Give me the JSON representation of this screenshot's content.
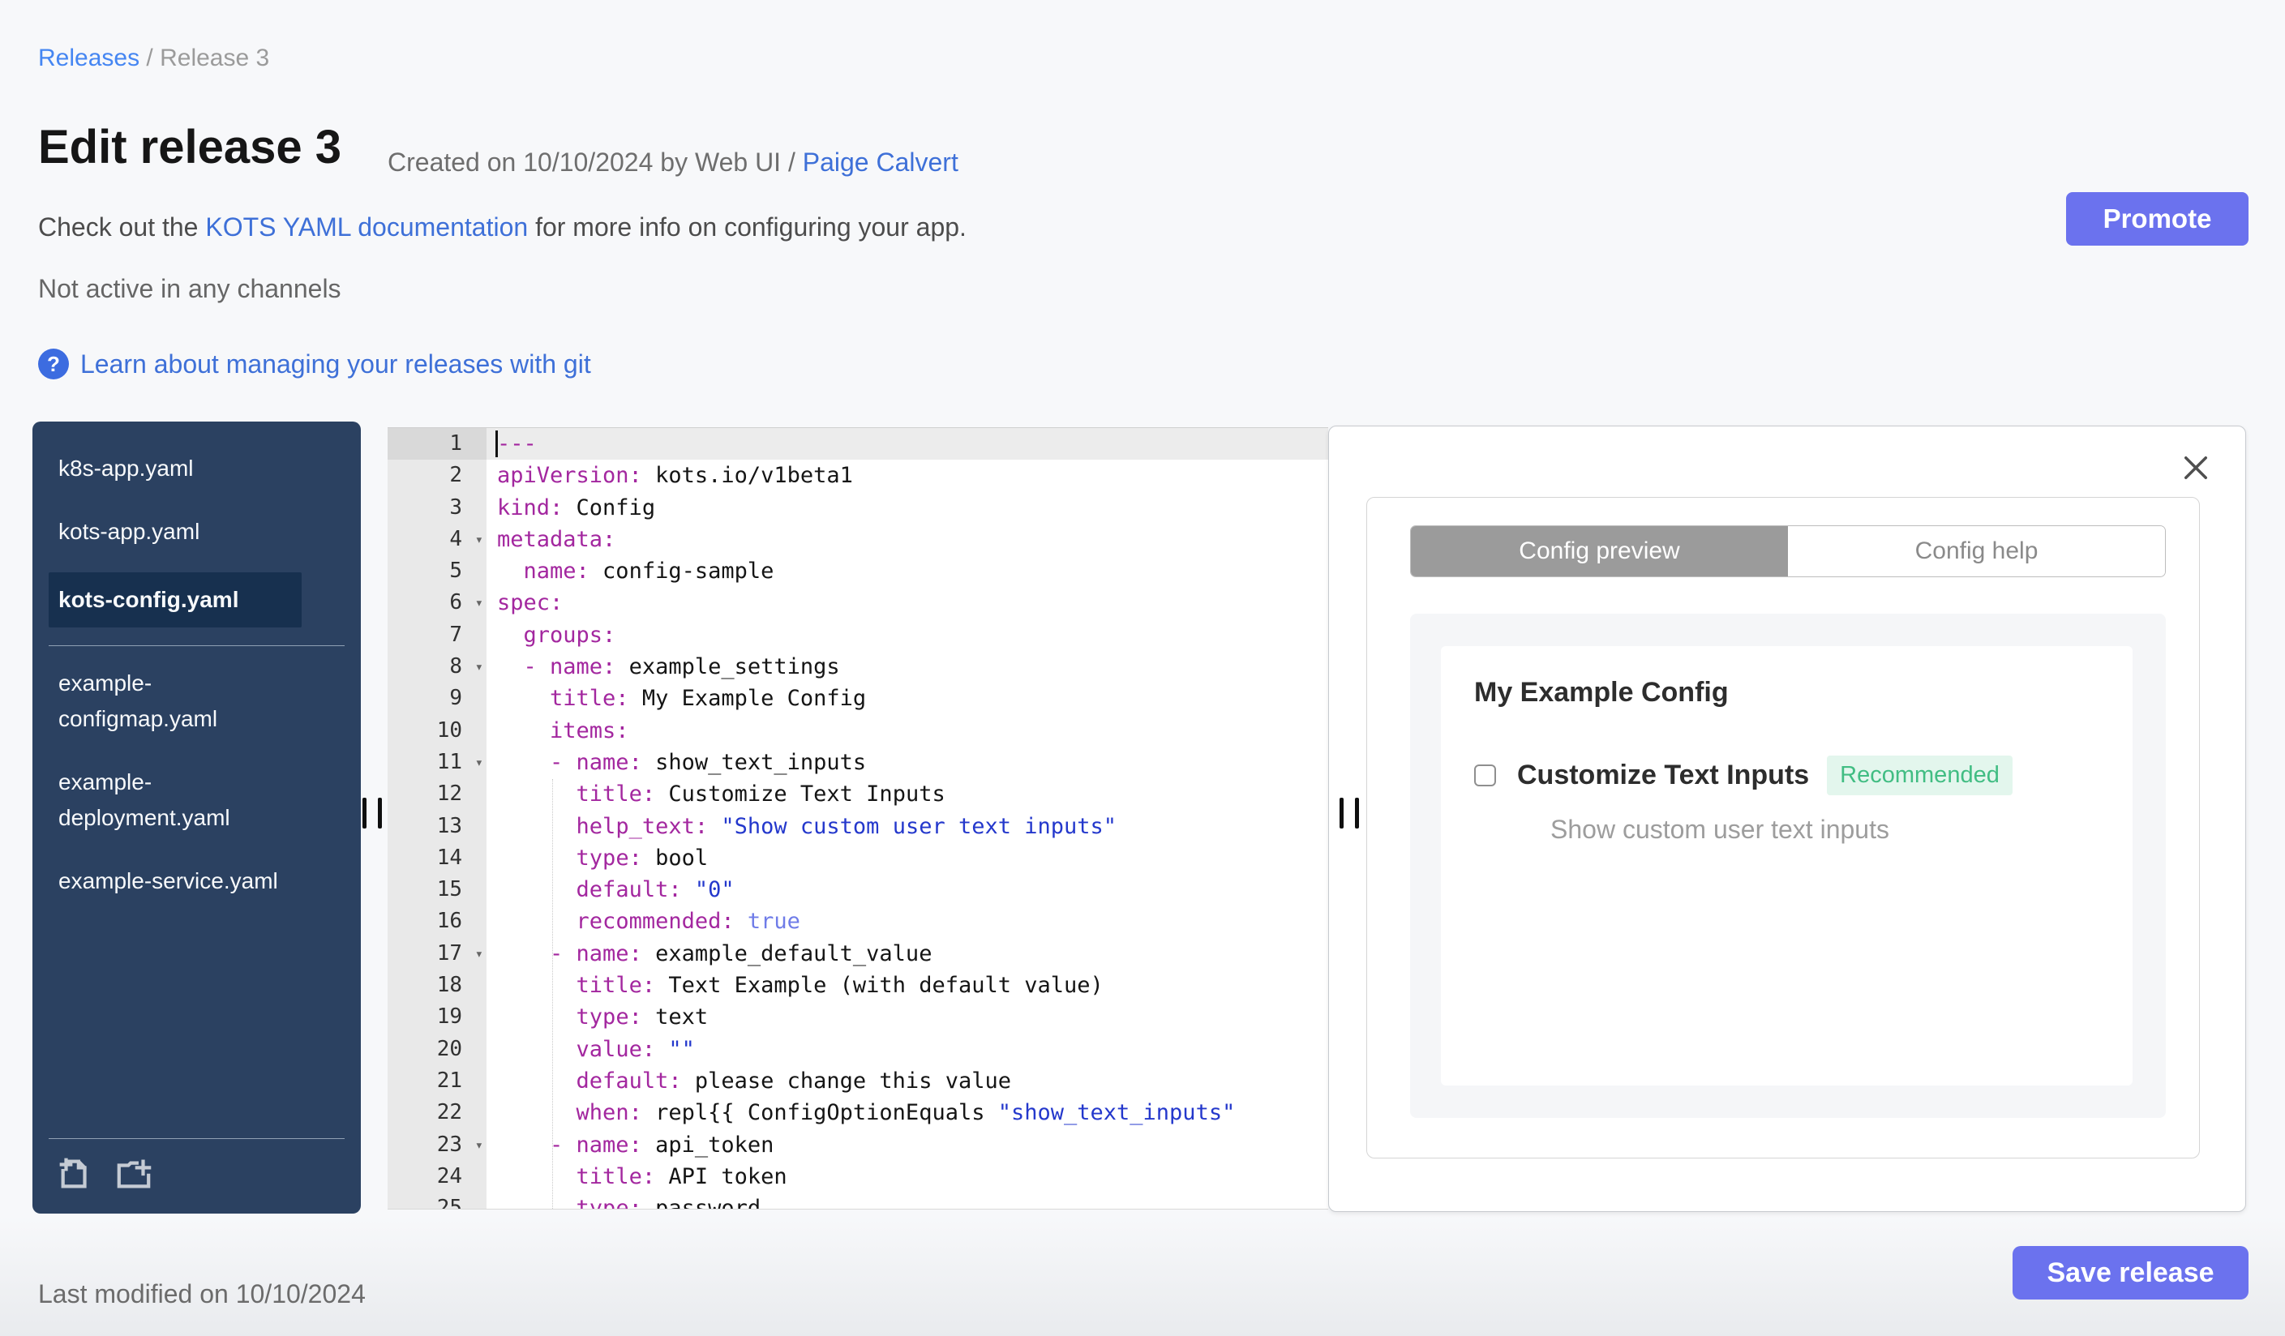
{
  "colors": {
    "accent": "#6b72ee",
    "link": "#3e70d8",
    "breadcrumb_link": "#4586f2",
    "sidebar_bg": "#2b4161",
    "sidebar_selected": "#17304f",
    "tab_active": "#9b9b9b",
    "badge_text": "#41bd83",
    "badge_bg": "#e3f6ed",
    "code_key": "#a3279f",
    "code_string": "#2438cc",
    "code_bool": "#6f7ce8"
  },
  "breadcrumb": {
    "link": "Releases",
    "separator": " / ",
    "current": "Release 3"
  },
  "header": {
    "title": "Edit release 3",
    "created_prefix": "Created on 10/10/2024 by Web UI / ",
    "created_link": "Paige Calvert",
    "doc_prefix": "Check out the ",
    "doc_link": "KOTS YAML documentation",
    "doc_suffix": " for more info on configuring your app.",
    "promote_label": "Promote",
    "status": "Not active in any channels",
    "help_icon": "?",
    "git_link": "Learn about managing your releases with git"
  },
  "sidebar": {
    "files_top": [
      {
        "label": "k8s-app.yaml",
        "selected": false
      },
      {
        "label": "kots-app.yaml",
        "selected": false
      },
      {
        "label": "kots-config.yaml",
        "selected": true
      }
    ],
    "files_bottom": [
      {
        "label": "example-configmap.yaml",
        "selected": false
      },
      {
        "label": "example-deployment.yaml",
        "selected": false
      },
      {
        "label": "example-service.yaml",
        "selected": false
      }
    ],
    "icons": [
      "new-file-icon",
      "new-folder-icon"
    ]
  },
  "editor": {
    "fold_icon": "▾",
    "lines": [
      {
        "fold": false,
        "active": true,
        "segs": [
          [
            "key",
            "---"
          ]
        ]
      },
      {
        "fold": false,
        "active": false,
        "segs": [
          [
            "key",
            "apiVersion:"
          ],
          [
            "plain",
            " kots.io/v1beta1"
          ]
        ]
      },
      {
        "fold": false,
        "active": false,
        "segs": [
          [
            "key",
            "kind:"
          ],
          [
            "plain",
            " Config"
          ]
        ]
      },
      {
        "fold": true,
        "active": false,
        "segs": [
          [
            "key",
            "metadata:"
          ]
        ]
      },
      {
        "fold": false,
        "active": false,
        "segs": [
          [
            "plain",
            "  "
          ],
          [
            "key",
            "name:"
          ],
          [
            "plain",
            " config-sample"
          ]
        ]
      },
      {
        "fold": true,
        "active": false,
        "segs": [
          [
            "key",
            "spec:"
          ]
        ]
      },
      {
        "fold": false,
        "active": false,
        "segs": [
          [
            "plain",
            "  "
          ],
          [
            "key",
            "groups:"
          ]
        ]
      },
      {
        "fold": true,
        "active": false,
        "segs": [
          [
            "plain",
            "  "
          ],
          [
            "key",
            "- name:"
          ],
          [
            "plain",
            " example_settings"
          ]
        ]
      },
      {
        "fold": false,
        "active": false,
        "segs": [
          [
            "plain",
            "    "
          ],
          [
            "key",
            "title:"
          ],
          [
            "plain",
            " My Example Config"
          ]
        ]
      },
      {
        "fold": false,
        "active": false,
        "segs": [
          [
            "plain",
            "    "
          ],
          [
            "key",
            "items:"
          ]
        ]
      },
      {
        "fold": true,
        "active": false,
        "segs": [
          [
            "plain",
            "    "
          ],
          [
            "key",
            "- name:"
          ],
          [
            "plain",
            " show_text_inputs"
          ]
        ]
      },
      {
        "fold": false,
        "active": false,
        "segs": [
          [
            "plain",
            "      "
          ],
          [
            "key",
            "title:"
          ],
          [
            "plain",
            " Customize Text Inputs"
          ]
        ]
      },
      {
        "fold": false,
        "active": false,
        "segs": [
          [
            "plain",
            "      "
          ],
          [
            "key",
            "help_text:"
          ],
          [
            "plain",
            " "
          ],
          [
            "string",
            "\"Show custom user text inputs\""
          ]
        ]
      },
      {
        "fold": false,
        "active": false,
        "segs": [
          [
            "plain",
            "      "
          ],
          [
            "key",
            "type:"
          ],
          [
            "plain",
            " bool"
          ]
        ]
      },
      {
        "fold": false,
        "active": false,
        "segs": [
          [
            "plain",
            "      "
          ],
          [
            "key",
            "default:"
          ],
          [
            "plain",
            " "
          ],
          [
            "string",
            "\"0\""
          ]
        ]
      },
      {
        "fold": false,
        "active": false,
        "segs": [
          [
            "plain",
            "      "
          ],
          [
            "key",
            "recommended:"
          ],
          [
            "plain",
            " "
          ],
          [
            "bool",
            "true"
          ]
        ]
      },
      {
        "fold": true,
        "active": false,
        "segs": [
          [
            "plain",
            "    "
          ],
          [
            "key",
            "- name:"
          ],
          [
            "plain",
            " example_default_value"
          ]
        ]
      },
      {
        "fold": false,
        "active": false,
        "segs": [
          [
            "plain",
            "      "
          ],
          [
            "key",
            "title:"
          ],
          [
            "plain",
            " Text Example (with default value)"
          ]
        ]
      },
      {
        "fold": false,
        "active": false,
        "segs": [
          [
            "plain",
            "      "
          ],
          [
            "key",
            "type:"
          ],
          [
            "plain",
            " text"
          ]
        ]
      },
      {
        "fold": false,
        "active": false,
        "segs": [
          [
            "plain",
            "      "
          ],
          [
            "key",
            "value:"
          ],
          [
            "plain",
            " "
          ],
          [
            "string",
            "\"\""
          ]
        ]
      },
      {
        "fold": false,
        "active": false,
        "segs": [
          [
            "plain",
            "      "
          ],
          [
            "key",
            "default:"
          ],
          [
            "plain",
            " please change this value"
          ]
        ]
      },
      {
        "fold": false,
        "active": false,
        "segs": [
          [
            "plain",
            "      "
          ],
          [
            "key",
            "when:"
          ],
          [
            "plain",
            " repl{{ ConfigOptionEquals "
          ],
          [
            "string",
            "\"show_text_inputs\""
          ]
        ]
      },
      {
        "fold": true,
        "active": false,
        "segs": [
          [
            "plain",
            "    "
          ],
          [
            "key",
            "- name:"
          ],
          [
            "plain",
            " api_token"
          ]
        ]
      },
      {
        "fold": false,
        "active": false,
        "segs": [
          [
            "plain",
            "      "
          ],
          [
            "key",
            "title:"
          ],
          [
            "plain",
            " API token"
          ]
        ]
      },
      {
        "fold": false,
        "active": false,
        "segs": [
          [
            "plain",
            "      "
          ],
          [
            "key",
            "type:"
          ],
          [
            "plain",
            " password"
          ]
        ]
      }
    ]
  },
  "preview": {
    "tabs": [
      {
        "label": "Config preview",
        "active": true
      },
      {
        "label": "Config help",
        "active": false
      }
    ],
    "group_title": "My Example Config",
    "item_label": "Customize Text Inputs",
    "item_badge": "Recommended",
    "item_help": "Show custom user text inputs",
    "item_checked": false
  },
  "footer": {
    "last_modified": "Last modified on 10/10/2024",
    "save_label": "Save release"
  }
}
